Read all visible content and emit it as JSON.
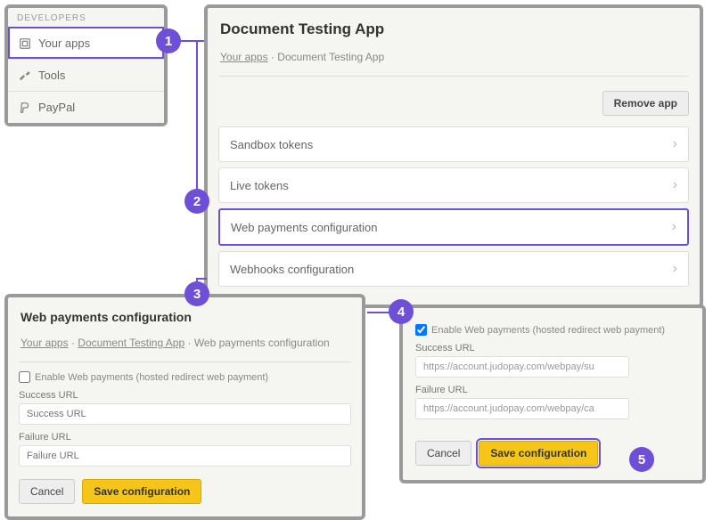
{
  "sidebar": {
    "header": "DEVELOPERS",
    "items": [
      {
        "label": "Your apps"
      },
      {
        "label": "Tools"
      },
      {
        "label": "PayPal"
      }
    ]
  },
  "app": {
    "title": "Document Testing App",
    "breadcrumb_root": "Your apps",
    "breadcrumb_sep": " · ",
    "breadcrumb_current": "Document Testing App",
    "remove_label": "Remove app",
    "rows": [
      {
        "label": "Sandbox tokens"
      },
      {
        "label": "Live tokens"
      },
      {
        "label": "Web payments configuration"
      },
      {
        "label": "Webhooks configuration"
      }
    ]
  },
  "config": {
    "title": "Web payments configuration",
    "breadcrumb_root": "Your apps",
    "breadcrumb_mid": "Document Testing App",
    "breadcrumb_current": "Web payments configuration",
    "enable_label": "Enable Web payments (hosted redirect web payment)",
    "success_label": "Success URL",
    "success_placeholder": "Success URL",
    "failure_label": "Failure URL",
    "failure_placeholder": "Failure URL",
    "cancel_label": "Cancel",
    "save_label": "Save configuration"
  },
  "config2": {
    "enable_label": "Enable Web payments (hosted redirect web payment)",
    "success_label": "Success URL",
    "success_value": "https://account.judopay.com/webpay/su",
    "failure_label": "Failure URL",
    "failure_value": "https://account.judopay.com/webpay/ca",
    "cancel_label": "Cancel",
    "save_label": "Save configuration"
  },
  "steps": {
    "s1": "1",
    "s2": "2",
    "s3": "3",
    "s4": "4",
    "s5": "5"
  },
  "sep": " · "
}
